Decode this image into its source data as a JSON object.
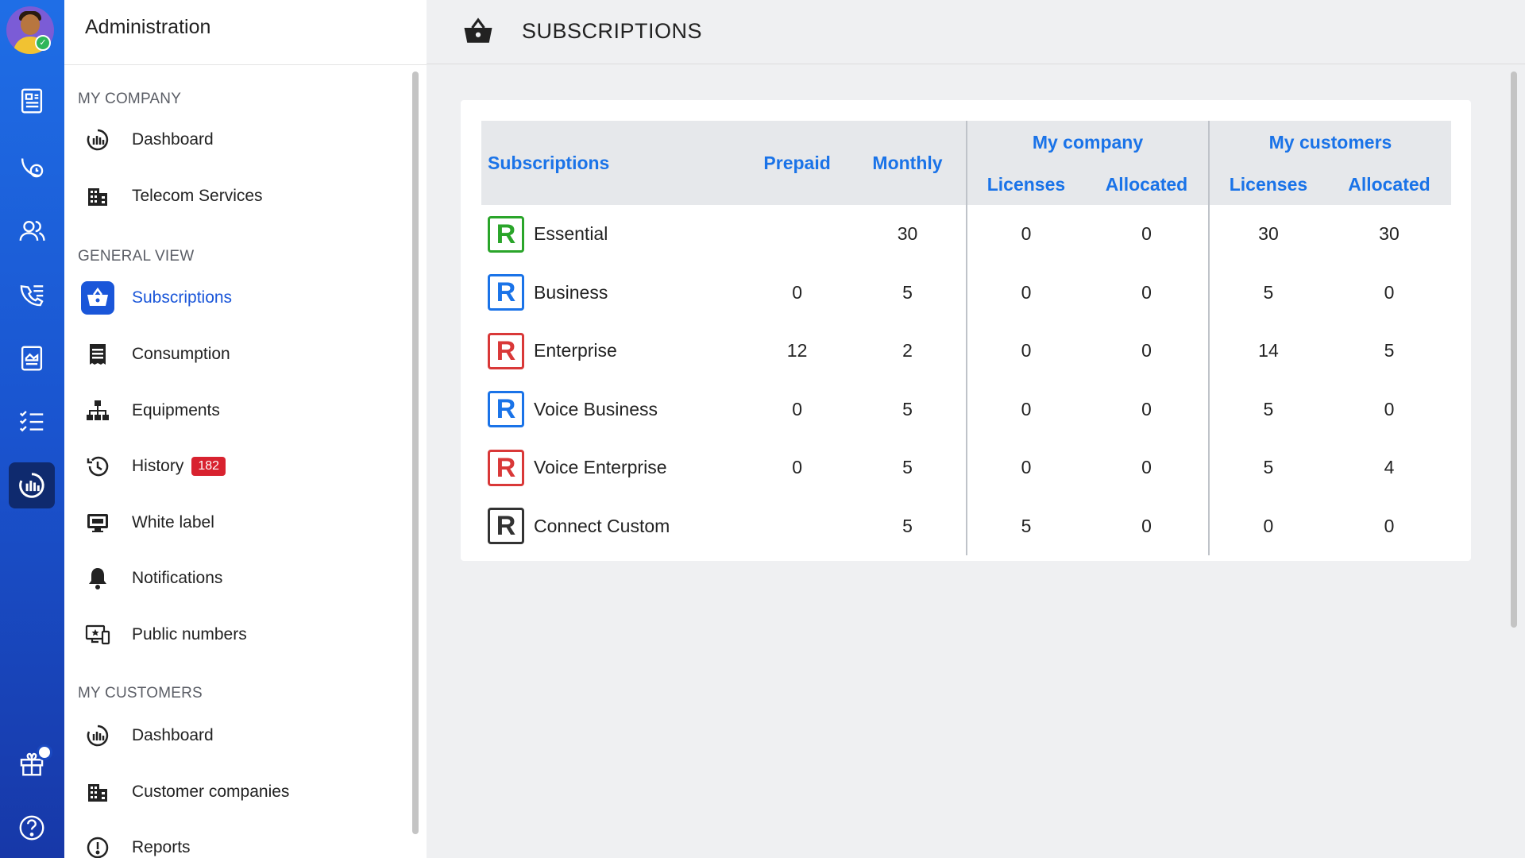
{
  "sidebar": {
    "title": "Administration",
    "sections": {
      "my_company": "MY COMPANY",
      "general_view": "GENERAL VIEW",
      "my_customers": "MY CUSTOMERS"
    },
    "my_company_items": [
      {
        "label": "Dashboard",
        "icon": "dashboard-gauge-icon"
      },
      {
        "label": "Telecom Services",
        "icon": "building-icon"
      }
    ],
    "general_items": [
      {
        "label": "Subscriptions",
        "icon": "basket-icon",
        "active": true
      },
      {
        "label": "Consumption",
        "icon": "receipt-icon"
      },
      {
        "label": "Equipments",
        "icon": "network-icon"
      },
      {
        "label": "History",
        "icon": "history-icon",
        "badge": "182"
      },
      {
        "label": "White label",
        "icon": "monitor-icon"
      },
      {
        "label": "Notifications",
        "icon": "bell-icon"
      },
      {
        "label": "Public numbers",
        "icon": "public-numbers-icon"
      }
    ],
    "customer_items": [
      {
        "label": "Dashboard",
        "icon": "dashboard-gauge-icon"
      },
      {
        "label": "Customer companies",
        "icon": "building-icon"
      },
      {
        "label": "Reports",
        "icon": "alert-circle-icon"
      }
    ]
  },
  "header": {
    "title": "SUBSCRIPTIONS"
  },
  "table": {
    "headers": {
      "subscriptions": "Subscriptions",
      "prepaid": "Prepaid",
      "monthly": "Monthly",
      "my_company": "My company",
      "my_customers": "My customers",
      "licenses": "Licenses",
      "allocated": "Allocated"
    },
    "rows": [
      {
        "name": "Essential",
        "color": "#2aa52a",
        "prepaid": "",
        "monthly": "30",
        "mc_licenses": "0",
        "mc_allocated": "0",
        "cu_licenses": "30",
        "cu_allocated": "30"
      },
      {
        "name": "Business",
        "color": "#1a73e8",
        "prepaid": "0",
        "monthly": "5",
        "mc_licenses": "0",
        "mc_allocated": "0",
        "cu_licenses": "5",
        "cu_allocated": "0"
      },
      {
        "name": "Enterprise",
        "color": "#d93838",
        "prepaid": "12",
        "monthly": "2",
        "mc_licenses": "0",
        "mc_allocated": "0",
        "cu_licenses": "14",
        "cu_allocated": "5"
      },
      {
        "name": "Voice Business",
        "color": "#1a73e8",
        "prepaid": "0",
        "monthly": "5",
        "mc_licenses": "0",
        "mc_allocated": "0",
        "cu_licenses": "5",
        "cu_allocated": "0"
      },
      {
        "name": "Voice Enterprise",
        "color": "#d93838",
        "prepaid": "0",
        "monthly": "5",
        "mc_licenses": "0",
        "mc_allocated": "0",
        "cu_licenses": "5",
        "cu_allocated": "4"
      },
      {
        "name": "Connect Custom",
        "color": "#333333",
        "prepaid": "",
        "monthly": "5",
        "mc_licenses": "5",
        "mc_allocated": "0",
        "cu_licenses": "0",
        "cu_allocated": "0"
      }
    ]
  },
  "logo_letter": "R",
  "colors": {
    "accent": "#1a73e8",
    "rail": "#1a54cf",
    "badge": "#d8222f"
  }
}
